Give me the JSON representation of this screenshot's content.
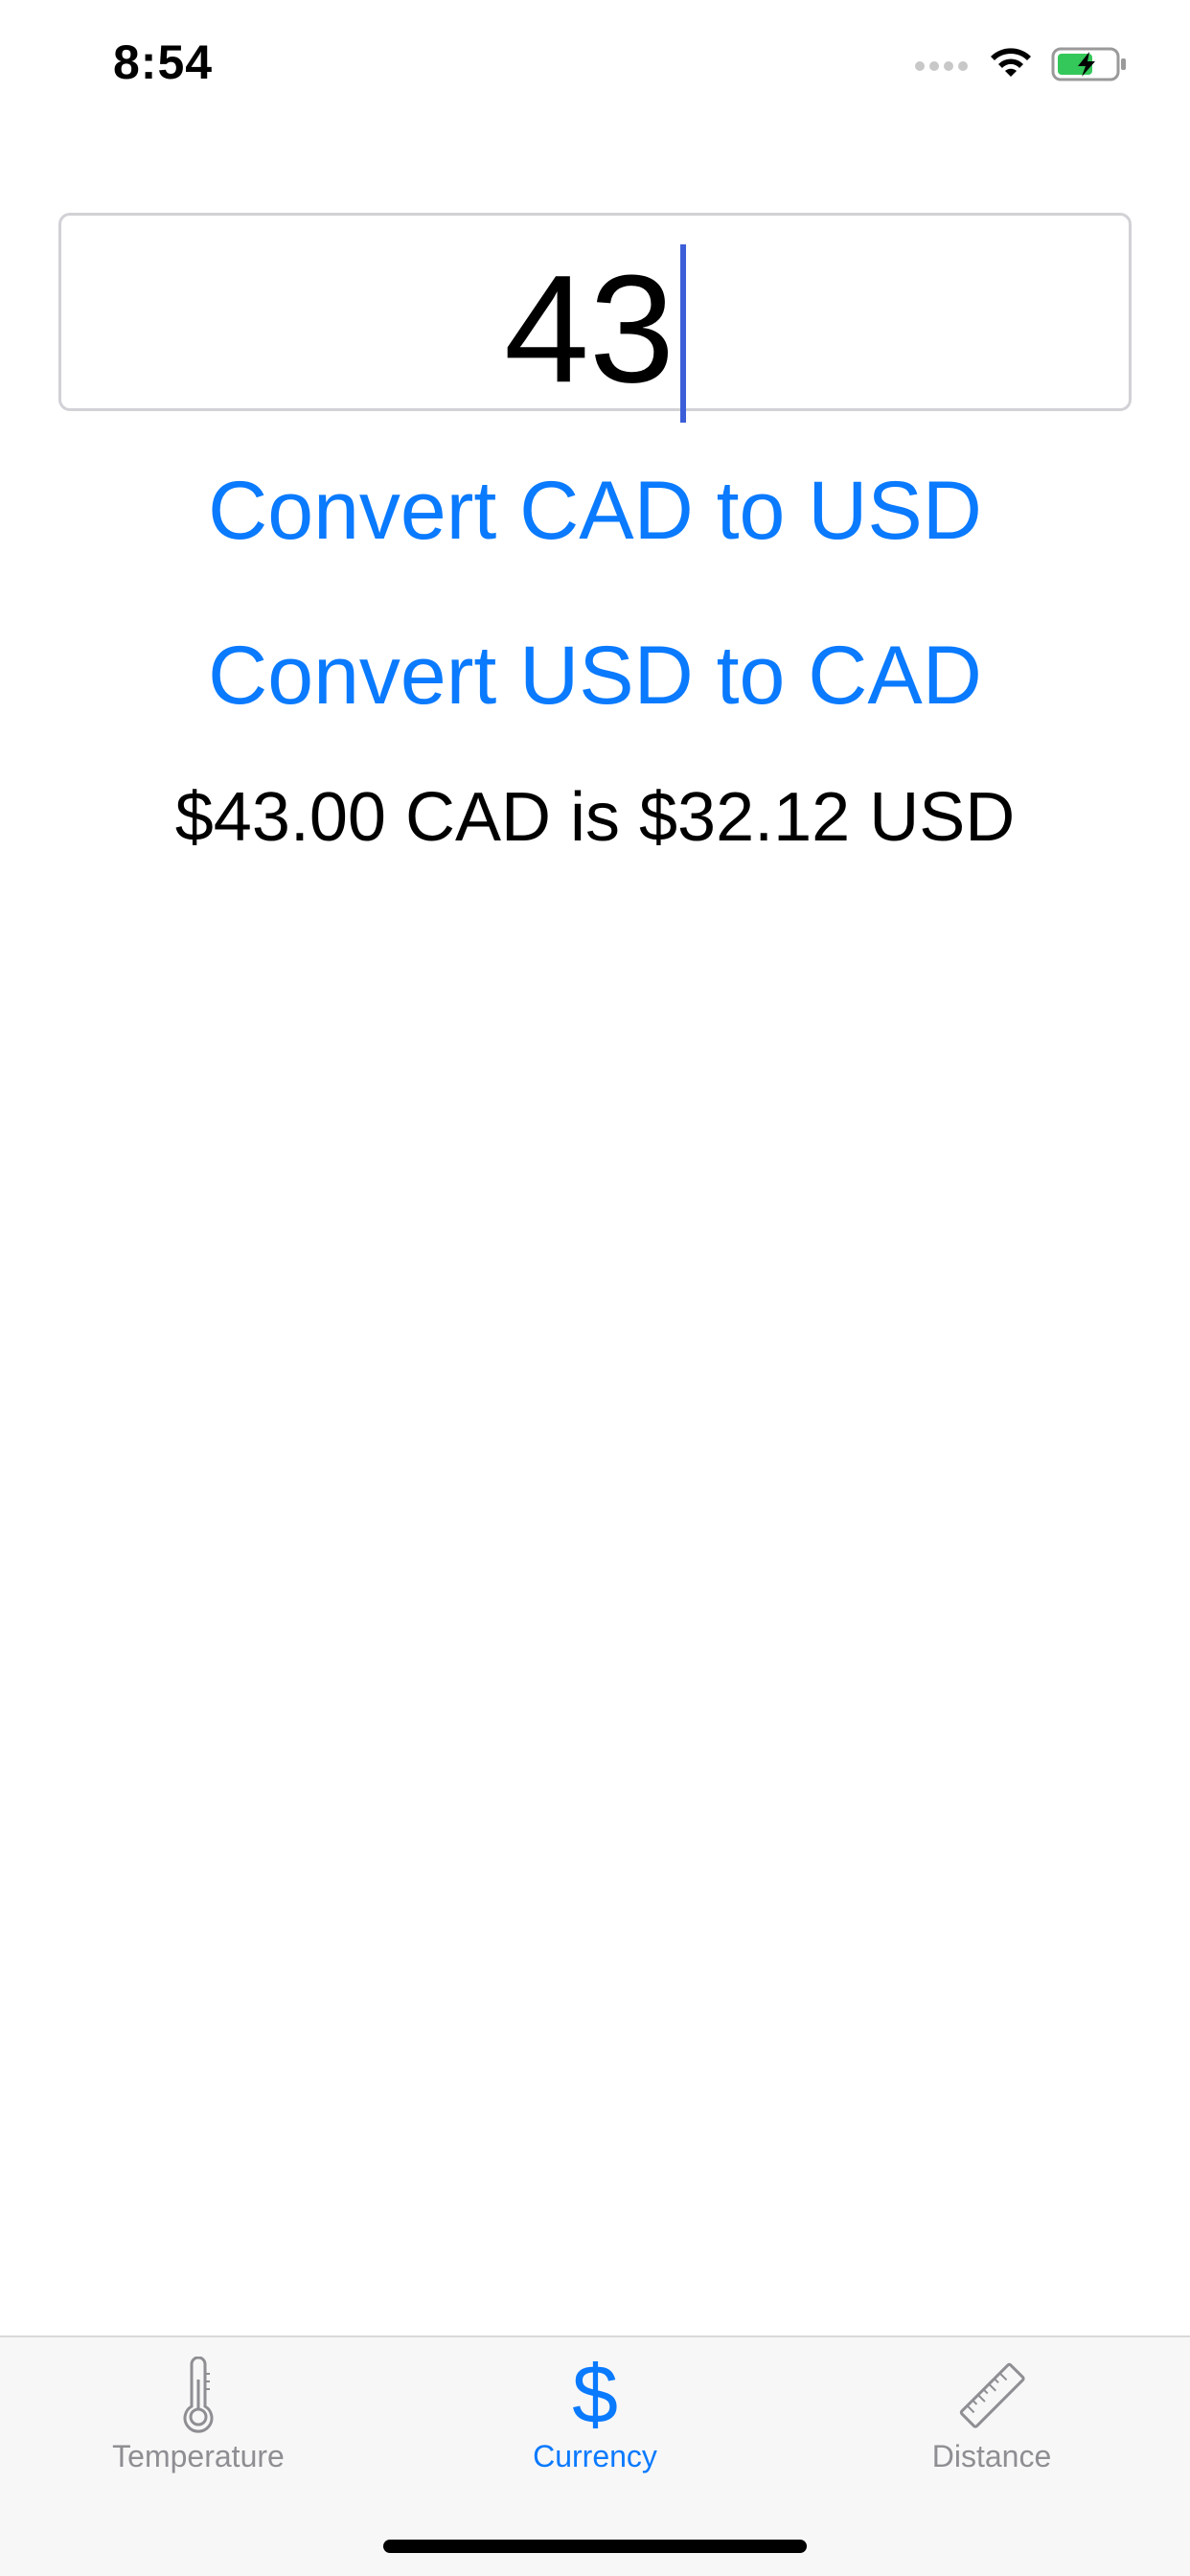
{
  "status_bar": {
    "time": "8:54",
    "icons": [
      "cellular-signal-icon",
      "wifi-icon",
      "battery-charging-icon"
    ]
  },
  "input": {
    "value": "43"
  },
  "buttons": {
    "cad_to_usd": "Convert CAD to USD",
    "usd_to_cad": "Convert USD to CAD"
  },
  "result": "$43.00 CAD is $32.12 USD",
  "tab_bar": {
    "tabs": [
      {
        "label": "Temperature",
        "icon": "thermometer-icon",
        "active": false
      },
      {
        "label": "Currency",
        "icon": "dollar-icon",
        "active": true
      },
      {
        "label": "Distance",
        "icon": "ruler-icon",
        "active": false
      }
    ]
  },
  "colors": {
    "accent": "#0a7aff",
    "inactive_tab": "#8e8e93",
    "battery_fill": "#34c759",
    "caret": "#3c5fd9"
  }
}
